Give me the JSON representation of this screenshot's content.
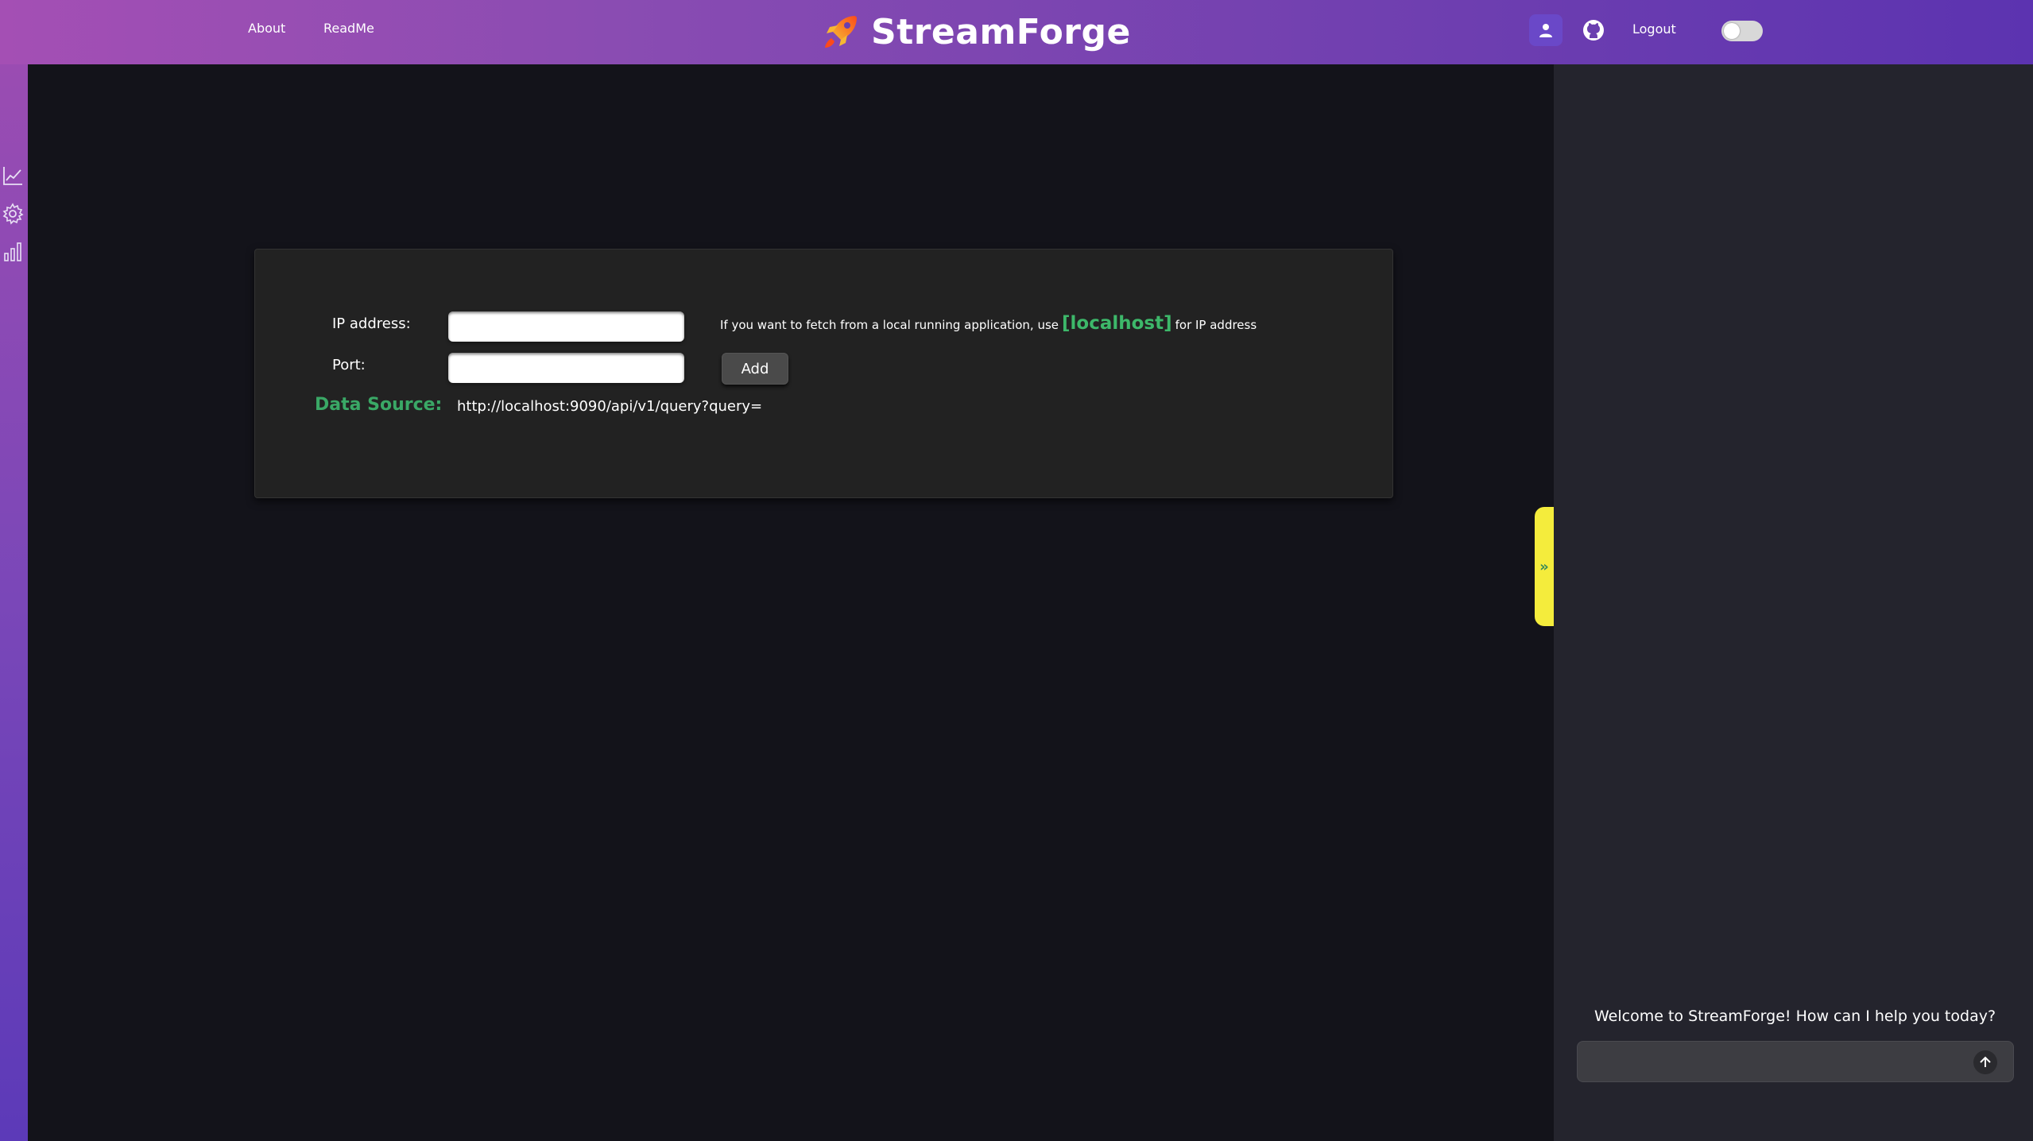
{
  "header": {
    "nav": {
      "about": "About",
      "readme": "ReadMe"
    },
    "brand": "StreamForge",
    "logout": "Logout",
    "icons": {
      "user": "user-icon",
      "github": "github-icon",
      "logo": "rocket-logo-icon"
    },
    "theme_toggle_on": false
  },
  "sidebar": {
    "icons": [
      "line-chart-icon",
      "gear-icon",
      "bar-chart-icon"
    ]
  },
  "form": {
    "ip_label": "IP address:",
    "ip_value": "",
    "port_label": "Port:",
    "port_value": "",
    "hint_prefix": "If you want to fetch from a local running application, use",
    "hint_highlight": "[localhost]",
    "hint_suffix": "for IP address",
    "add_button": "Add",
    "data_source_label": "Data Source:",
    "data_source_url": "http://localhost:9090/api/v1/query?query="
  },
  "chat": {
    "collapse_glyph": "»",
    "welcome": "Welcome to StreamForge! How can I help you today?",
    "input_value": "",
    "send_icon": "arrow-up-icon"
  },
  "colors": {
    "accent_green": "#3aa866",
    "collapse_tab": "#f4ec3c",
    "header_gradient_start": "#a44fb4",
    "header_gradient_end": "#5c33b0"
  }
}
